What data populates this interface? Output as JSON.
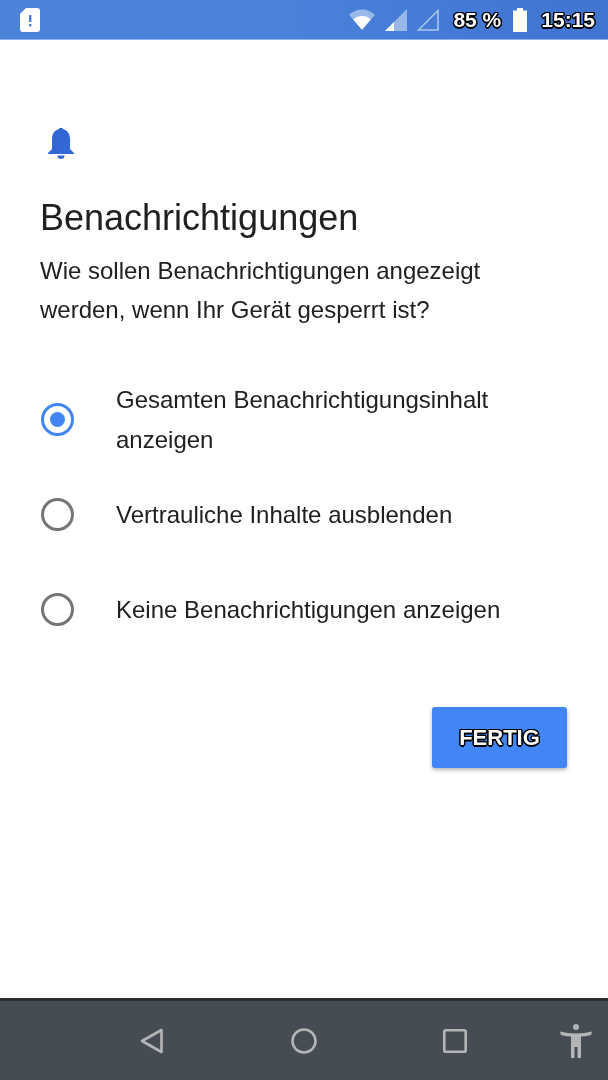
{
  "status_bar": {
    "battery_text": "85 %",
    "time": "15:15"
  },
  "header": {
    "title": "Benachrichtigungen",
    "description": "Wie sollen Benachrichtigungen angezeigt werden, wenn Ihr Gerät gesperrt ist?"
  },
  "options": [
    {
      "label": "Gesamten Benachrichtigungsinhalt anzeigen",
      "selected": true
    },
    {
      "label": "Vertrauliche Inhalte ausblenden",
      "selected": false
    },
    {
      "label": "Keine Benachrichtigungen anzeigen",
      "selected": false
    }
  ],
  "done_button": {
    "label": "FERTIG"
  }
}
